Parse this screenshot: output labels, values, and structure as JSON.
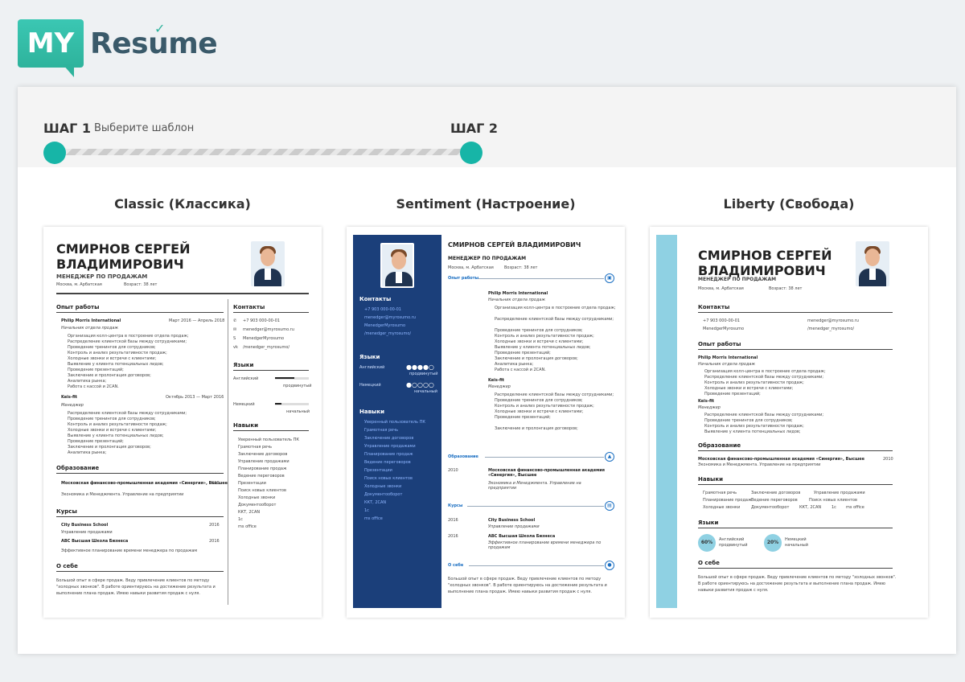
{
  "logo": {
    "my": "MY",
    "word": "Resume"
  },
  "steps": [
    {
      "label": "ШАГ 1",
      "sub": "Выберите шаблон"
    },
    {
      "label": "ШАГ 2"
    }
  ],
  "templates": [
    {
      "title": "Classic (Классика)"
    },
    {
      "title": "Sentiment (Настроение)"
    },
    {
      "title": "Liberty (Свобода)"
    }
  ],
  "resume": {
    "name_l1": "СМИРНОВ СЕРГЕЙ",
    "name_l2": "ВЛАДИМИРОВИЧ",
    "name_full": "СМИРНОВ СЕРГЕЙ ВЛАДИМИРОВИЧ",
    "position": "МЕНЕДЖЕР ПО ПРОДАЖАМ",
    "city": "Москва, м. Арбатская",
    "age": "Возраст: 38 лет",
    "sec_experience": "Опыт работы",
    "sec_contacts": "Контакты",
    "sec_languages": "Языки",
    "sec_skills": "Навыки",
    "sec_education": "Образование",
    "sec_courses": "Курсы",
    "sec_about": "О себе",
    "phone": "+7 903 000-00-01",
    "email": "menedger@myrosumo.ru",
    "skype": "MenedgerMyrosumo",
    "vk": "/menedger_myrosumo/",
    "company1": "Philip Morris International",
    "dates1": "Март 2016 — Апрель 2018",
    "role1": "Начальник отдела продаж",
    "company2": "Keis-fit",
    "dates2": "Октябрь 2013 — Март 2016",
    "role2": "Менеджер",
    "edu": "Московская финансово-промышленная академия «Синергия», Высшее",
    "edu_sub": "Экономика и Менеджмента. Управление на предприятии",
    "edu_year": "2010",
    "course1": "City Business School",
    "course1_sub": "Управление продажами",
    "course2": "ABC Высшая Школа Бизнеса",
    "course2_sub": "Эффективное планирование времени менеджера по продажам",
    "course_year": "2016",
    "lang1": "Английский",
    "lang1_lvl": "продвинутый",
    "lang2": "Немецкий",
    "lang2_lvl": "начальный",
    "about": "Большой опыт в сфере продаж. Веду привлечение клиентов по методу \"холодных звонков\". В работе ориентируюсь на достижение результата и выполнение плана продаж. Имею навыки развития продаж с нуля.",
    "skills": [
      "Уверенный пользователь ПК",
      "Грамотная речь",
      "Заключение договоров",
      "Управление продажами",
      "Планирование продаж",
      "Ведение переговоров",
      "Презентации",
      "Поиск новых клиентов",
      "Холодные звонки",
      "Документооборот",
      "ККТ, 2CAN",
      "1с",
      "ms office"
    ],
    "bullets": [
      "Организация колл-центра в построение отдела продаж;",
      "Распределение клиентской базы между сотрудниками;",
      "Проведение тренингов для сотрудников;",
      "Контроль и анализ результативности продаж;",
      "Холодные звонки и встречи с клиентами;",
      "Выявление у клиента потенциальных лидов;",
      "Проведение презентаций;",
      "Заключение и пролонгация договоров;",
      "Аналитика рынка;",
      "Работа с кассой и 2CAN."
    ],
    "lang_pct1": "60%",
    "lang_pct2": "20%"
  }
}
